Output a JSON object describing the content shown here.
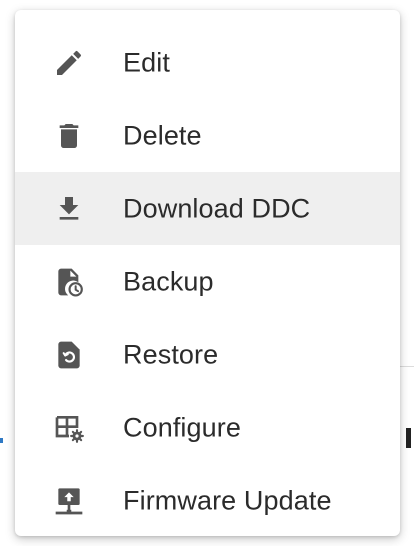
{
  "menu": {
    "items": [
      {
        "label": "Edit",
        "icon": "pencil-icon"
      },
      {
        "label": "Delete",
        "icon": "trash-icon"
      },
      {
        "label": "Download DDC",
        "icon": "download-icon",
        "highlighted": true
      },
      {
        "label": "Backup",
        "icon": "backup-file-icon"
      },
      {
        "label": "Restore",
        "icon": "restore-file-icon"
      },
      {
        "label": "Configure",
        "icon": "configure-grid-gear-icon"
      },
      {
        "label": "Firmware Update",
        "icon": "firmware-update-icon"
      }
    ]
  },
  "colors": {
    "icon": "#555555",
    "text": "#2b2b2b",
    "hover_background": "#efefef"
  }
}
